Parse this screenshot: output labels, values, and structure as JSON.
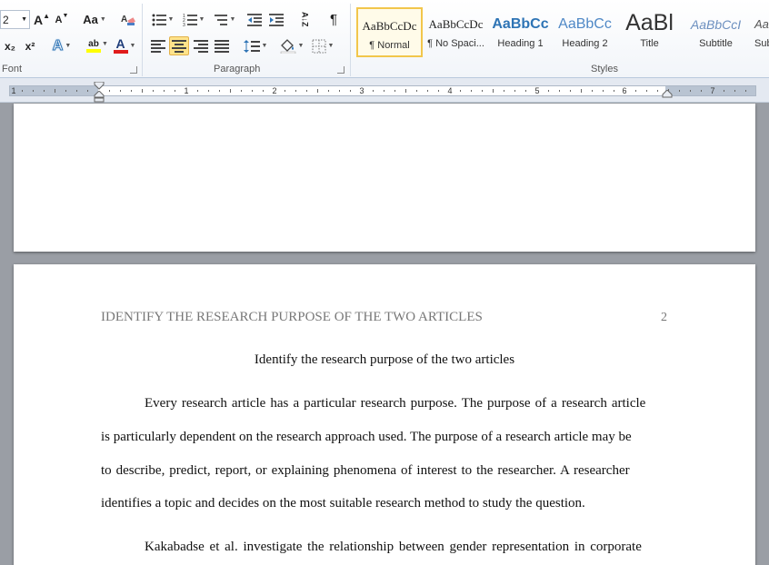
{
  "ribbon": {
    "font": {
      "size_value": "2",
      "grow_font": "A",
      "shrink_font": "A",
      "change_case": "Aa",
      "subscript": "x₂",
      "superscript": "x²",
      "text_effects": "A",
      "highlight_label": "ab",
      "font_color_label": "A",
      "group_label": "Font"
    },
    "paragraph": {
      "sort": "A↓Z",
      "show_marks": "¶",
      "group_label": "Paragraph"
    },
    "styles": {
      "group_label": "Styles",
      "items": [
        {
          "sample": "AaBbCcDc",
          "name": "¶ Normal"
        },
        {
          "sample": "AaBbCcDc",
          "name": "¶ No Spaci..."
        },
        {
          "sample": "AaBbCc",
          "name": "Heading 1"
        },
        {
          "sample": "AaBbCc",
          "name": "Heading 2"
        },
        {
          "sample": "AaBl",
          "name": "Title"
        },
        {
          "sample": "AaBbCcI",
          "name": "Subtitle"
        },
        {
          "sample": "AaBbCcDc",
          "name": "Sub"
        }
      ]
    }
  },
  "ruler": {
    "labels": [
      "1",
      "1",
      "2",
      "3",
      "4",
      "5",
      "6",
      "7"
    ]
  },
  "document": {
    "page2": {
      "running_head": "IDENTIFY THE RESEARCH PURPOSE OF THE TWO ARTICLES",
      "page_number": "2",
      "title": "Identify the research purpose of the two articles",
      "para1": [
        "Every research article has a particular research purpose. The purpose of a research article",
        "is particularly dependent on the research approach used. The purpose of a research article may be",
        "to describe, predict, report, or explaining phenomena of interest to the researcher. A researcher",
        "identifies a topic and decides on the most suitable research method to study the question."
      ],
      "para2": [
        "Kakabadse et al. investigate the relationship between gender representation in corporate"
      ]
    }
  },
  "colors": {
    "accent_highlight": "#ffe38a",
    "highlight_yellow": "#ffff00",
    "font_color_red": "#e01b1b",
    "heading_blue": "#2e74b5",
    "page_background": "#9a9ea5"
  }
}
